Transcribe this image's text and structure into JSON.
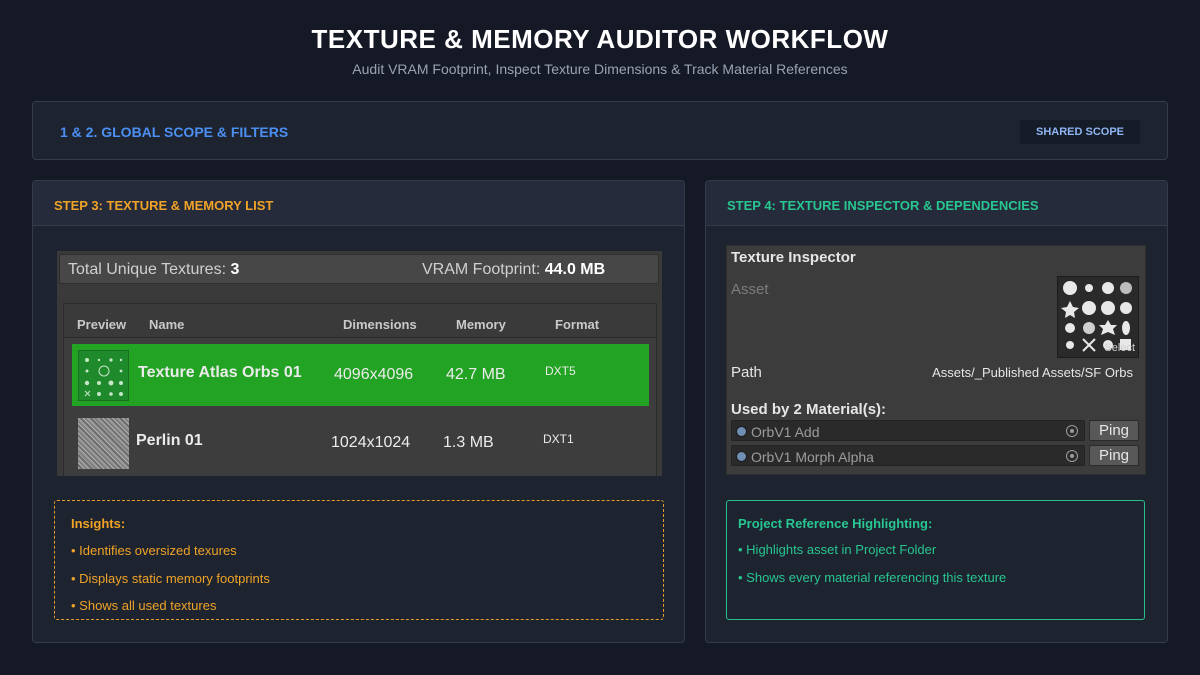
{
  "header": {
    "title": "TEXTURE & MEMORY AUDITOR WORKFLOW",
    "subtitle": "Audit VRAM Footprint, Inspect Texture Dimensions & Track Material References"
  },
  "scope": {
    "label": "1 & 2. GLOBAL SCOPE & FILTERS",
    "badge": "SHARED SCOPE"
  },
  "step3": {
    "title": "STEP 3: TEXTURE & MEMORY LIST",
    "summary": {
      "unique_label": "Total Unique Textures:",
      "unique_value": "3",
      "vram_label": "VRAM Footprint:",
      "vram_value": "44.0 MB"
    },
    "columns": [
      "Preview",
      "Name",
      "Dimensions",
      "Memory",
      "Format"
    ],
    "rows": [
      {
        "name": "Texture Atlas Orbs 01",
        "dimensions": "4096x4096",
        "memory": "42.7 MB",
        "format": "DXT5",
        "selected": true
      },
      {
        "name": "Perlin 01",
        "dimensions": "1024x1024",
        "memory": "1.3 MB",
        "format": "DXT1",
        "selected": false
      }
    ],
    "insights": {
      "heading": "Insights:",
      "items": [
        "• Identifies oversized texures",
        "• Displays static memory footprints",
        "• Shows all used textures"
      ]
    }
  },
  "step4": {
    "title": "STEP 4: TEXTURE INSPECTOR & DEPENDENCIES",
    "inspector": {
      "title": "Texture Inspector",
      "asset_label": "Asset",
      "select_label": "Select",
      "path_label": "Path",
      "path_value": "Assets/_Published Assets/SF Orbs",
      "used_by": "Used by 2 Material(s):",
      "materials": [
        {
          "name": "OrbV1 Add",
          "ping": "Ping"
        },
        {
          "name": "OrbV1 Morph Alpha",
          "ping": "Ping"
        }
      ]
    },
    "highlighting": {
      "heading": "Project Reference Highlighting:",
      "items": [
        "• Highlights asset in Project Folder",
        "• Shows every material referencing this texture"
      ]
    }
  },
  "colors": {
    "accent_blue": "#4b8ff2",
    "accent_orange": "#f0a326",
    "accent_green": "#28c690",
    "selection_green": "#23a323"
  }
}
